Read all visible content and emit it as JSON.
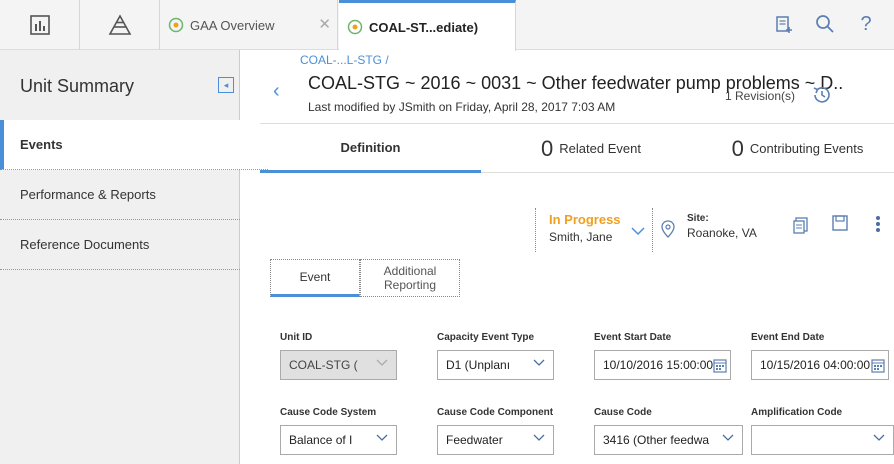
{
  "topbar": {
    "tabs": [
      {
        "label": "GAA Overview"
      },
      {
        "label": "COAL-ST...ediate)"
      }
    ]
  },
  "sidebar": {
    "title": "Unit Summary",
    "items": [
      {
        "label": "Events"
      },
      {
        "label": "Performance & Reports"
      },
      {
        "label": "Reference Documents"
      }
    ]
  },
  "record": {
    "breadcrumb": "COAL-...L-STG /",
    "title": "COAL-STG ~ 2016 ~ 0031 ~ Other feedwater pump problems ~ D..",
    "modified": "Last modified by JSmith on Friday, April 28, 2017 7:03 AM",
    "revisions": "1 Revision(s)"
  },
  "section_tabs": {
    "definition": "Definition",
    "related_count": "0",
    "related_label": "Related Event",
    "contributing_count": "0",
    "contributing_label": "Contributing Events"
  },
  "state": {
    "status": "In Progress",
    "owner": "Smith, Jane",
    "site_label": "Site:",
    "site_value": "Roanoke, VA"
  },
  "form_tabs": {
    "event": "Event",
    "additional": "Additional Reporting"
  },
  "fields": {
    "unit_id": {
      "label": "Unit ID",
      "value": "COAL-STG ("
    },
    "capacity_type": {
      "label": "Capacity Event Type",
      "value": "D1 (Unplanı"
    },
    "start_date": {
      "label": "Event Start Date",
      "value": "10/10/2016 15:00:00"
    },
    "end_date": {
      "label": "Event End Date",
      "value": "10/15/2016 04:00:00"
    },
    "cause_system": {
      "label": "Cause Code System",
      "value": "Balance of I"
    },
    "cause_component": {
      "label": "Cause Code Component",
      "value": "Feedwater"
    },
    "cause_code": {
      "label": "Cause Code",
      "value": "3416 (Other feedwa"
    },
    "amplification": {
      "label": "Amplification Code",
      "value": ""
    }
  },
  "colors": {
    "accent": "#4a90d9",
    "status": "#f0a020"
  }
}
